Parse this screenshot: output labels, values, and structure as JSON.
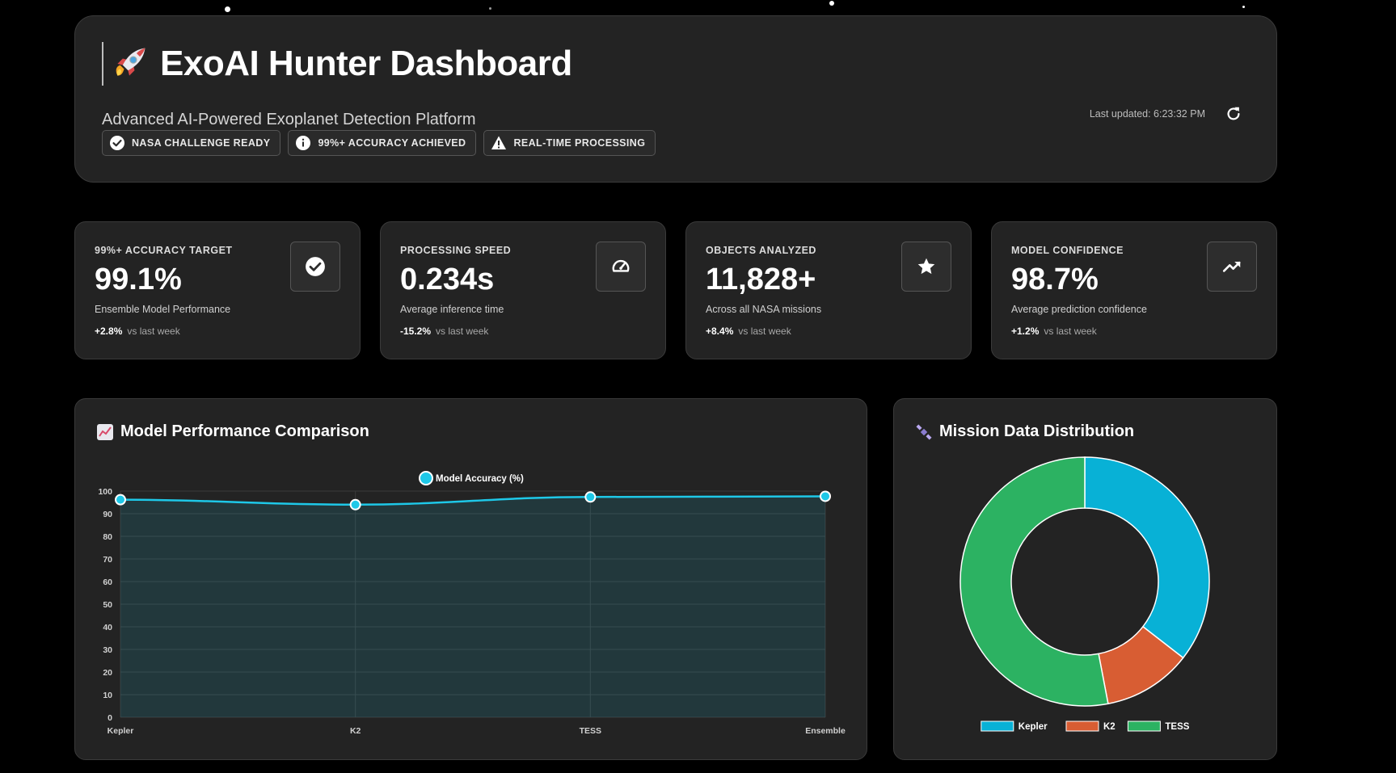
{
  "header": {
    "title": "ExoAI Hunter Dashboard",
    "subtitle": "Advanced AI-Powered Exoplanet Detection Platform",
    "last_updated": "Last updated: 6:23:32 PM",
    "badges": [
      {
        "label": "NASA CHALLENGE READY",
        "icon": "check-circle-icon"
      },
      {
        "label": "99%+ ACCURACY ACHIEVED",
        "icon": "info-icon"
      },
      {
        "label": "REAL-TIME PROCESSING",
        "icon": "warning-icon"
      }
    ]
  },
  "stats": [
    {
      "label": "99%+ ACCURACY TARGET",
      "value": "99.1%",
      "desc": "Ensemble Model Performance",
      "change": "+2.8%",
      "vs": "vs last week",
      "icon": "check-circle-icon"
    },
    {
      "label": "PROCESSING SPEED",
      "value": "0.234s",
      "desc": "Average inference time",
      "change": "-15.2%",
      "vs": "vs last week",
      "icon": "speedometer-icon"
    },
    {
      "label": "OBJECTS ANALYZED",
      "value": "11,828+",
      "desc": "Across all NASA missions",
      "change": "+8.4%",
      "vs": "vs last week",
      "icon": "star-icon"
    },
    {
      "label": "MODEL CONFIDENCE",
      "value": "98.7%",
      "desc": "Average prediction confidence",
      "change": "+1.2%",
      "vs": "vs last week",
      "icon": "trending-up-icon"
    }
  ],
  "panels": {
    "performance_title": "Model Performance Comparison",
    "distribution_title": "Mission Data Distribution"
  },
  "colors": {
    "line": "#1ec8e8",
    "kepler": "#08b1d6",
    "k2": "#d85d33",
    "tess": "#2cb262"
  },
  "chart_data": [
    {
      "type": "line",
      "categories": [
        "Kepler",
        "K2",
        "TESS",
        "Ensemble"
      ],
      "series": [
        {
          "name": "Model Accuracy (%)",
          "values": [
            96.2,
            94.0,
            97.4,
            97.7
          ]
        }
      ],
      "ylim": [
        0,
        100
      ],
      "yticks": [
        0,
        10,
        20,
        30,
        40,
        50,
        60,
        70,
        80,
        90,
        100
      ],
      "grid": true,
      "legend": "top"
    },
    {
      "type": "pie",
      "donut": true,
      "labels": [
        "Kepler",
        "K2",
        "TESS"
      ],
      "values": [
        35.5,
        11.5,
        53.0
      ],
      "legend": "bottom"
    }
  ]
}
